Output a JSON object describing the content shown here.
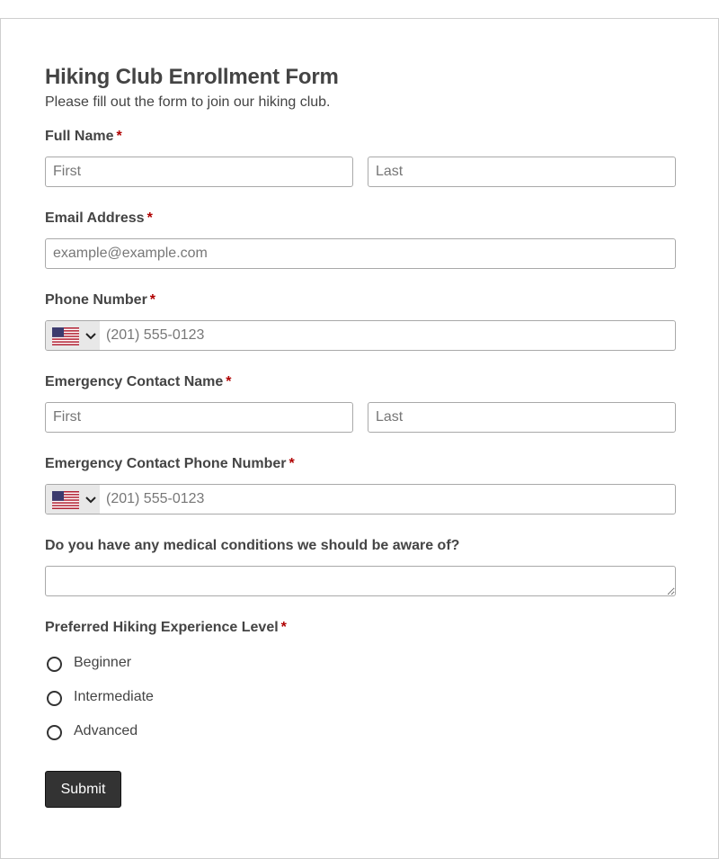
{
  "form": {
    "title": "Hiking Club Enrollment Form",
    "subtitle": "Please fill out the form to join our hiking club.",
    "required_marker": "*"
  },
  "full_name": {
    "label": "Full Name",
    "first_placeholder": "First",
    "last_placeholder": "Last",
    "first_value": "",
    "last_value": ""
  },
  "email": {
    "label": "Email Address",
    "placeholder": "example@example.com",
    "value": ""
  },
  "phone": {
    "label": "Phone Number",
    "country_icon": "us-flag-icon",
    "placeholder": "(201) 555-0123",
    "value": ""
  },
  "emergency_name": {
    "label": "Emergency Contact Name",
    "first_placeholder": "First",
    "last_placeholder": "Last",
    "first_value": "",
    "last_value": ""
  },
  "emergency_phone": {
    "label": "Emergency Contact Phone Number",
    "country_icon": "us-flag-icon",
    "placeholder": "(201) 555-0123",
    "value": ""
  },
  "medical": {
    "label": "Do you have any medical conditions we should be aware of?",
    "value": ""
  },
  "experience": {
    "label": "Preferred Hiking Experience Level",
    "options": [
      {
        "label": "Beginner",
        "selected": false
      },
      {
        "label": "Intermediate",
        "selected": false
      },
      {
        "label": "Advanced",
        "selected": false
      }
    ]
  },
  "submit": {
    "label": "Submit"
  },
  "colors": {
    "required": "#b00000",
    "button_bg": "#333333",
    "border": "#a9a9a9",
    "text": "#444444"
  }
}
